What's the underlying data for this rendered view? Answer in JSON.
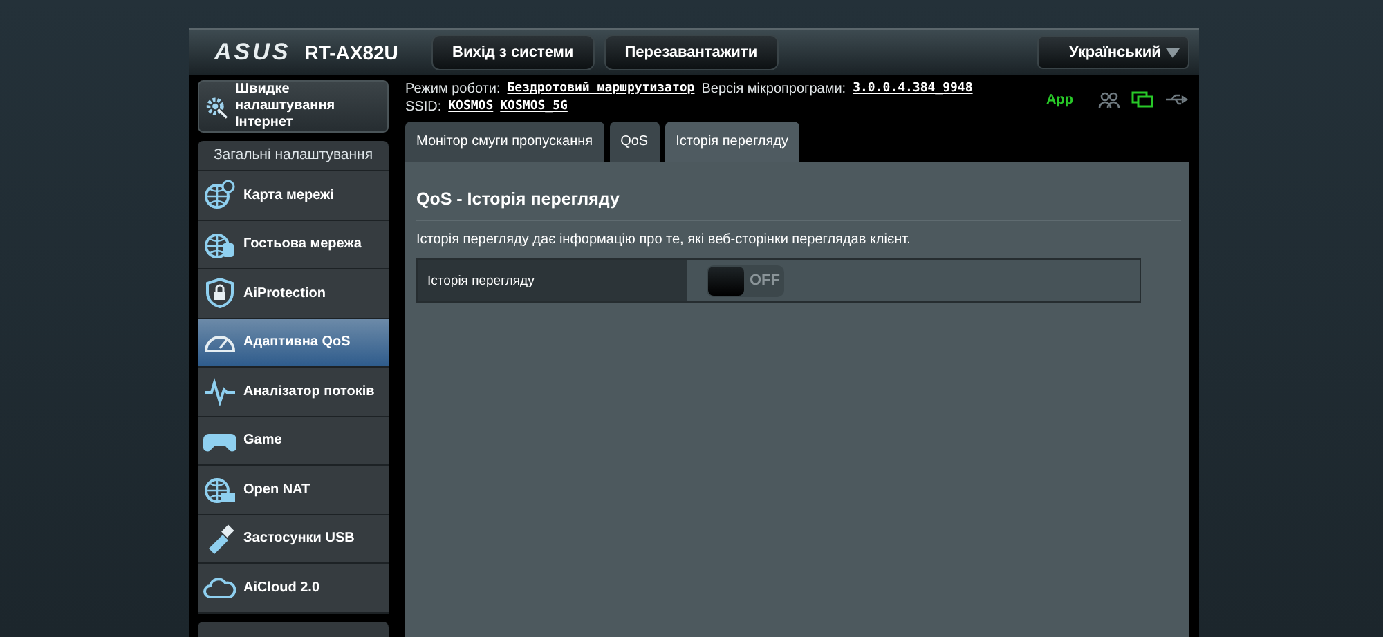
{
  "header": {
    "logo": "ASUS",
    "model": "RT-AX82U",
    "buttons": [
      "Вихід з системи",
      "Перезавантажити"
    ],
    "language": "Український"
  },
  "info": {
    "mode_label": "Режим роботи:",
    "mode_value": "Бездротовий маршрутизатор",
    "firmware_label": "Версія мікропрограми:",
    "firmware_value": "3.0.0.4.384_9948",
    "ssid_label": "SSID:",
    "ssids": [
      "KOSMOS",
      "KOSMOS_5G"
    ],
    "app_label": "App"
  },
  "sidebar": {
    "quick_setup": "Швидке налаштування Інтернет",
    "section": "Загальні налаштування",
    "items": [
      {
        "label": "Карта мережі",
        "selected": false
      },
      {
        "label": "Гостьова мережа",
        "selected": false
      },
      {
        "label": "AiProtection",
        "selected": false
      },
      {
        "label": "Адаптивна QoS",
        "selected": true
      },
      {
        "label": "Аналізатор потоків",
        "selected": false
      },
      {
        "label": "Game",
        "selected": false
      },
      {
        "label": "Open NAT",
        "selected": false
      },
      {
        "label": "Застосунки USB",
        "selected": false
      },
      {
        "label": "AiCloud 2.0",
        "selected": false
      }
    ]
  },
  "tabs": [
    {
      "label": "Монітор смуги пропускання",
      "selected": false
    },
    {
      "label": "QoS",
      "selected": false
    },
    {
      "label": "Історія перегляду",
      "selected": true
    }
  ],
  "panel": {
    "title": "QoS - Історія перегляду",
    "description": "Історія перегляду дає інформацію про те, які веб-сторінки переглядав клієнт.",
    "setting": {
      "label": "Історія перегляду",
      "on": false,
      "state_text": "OFF"
    }
  }
}
